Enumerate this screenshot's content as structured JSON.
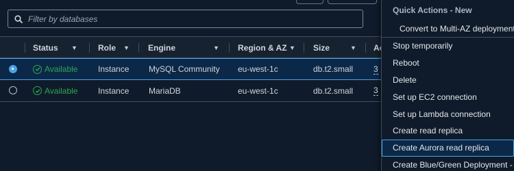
{
  "search": {
    "placeholder": "Filter by databases",
    "value": ""
  },
  "table": {
    "columns": [
      "Status",
      "Role",
      "Engine",
      "Region & AZ",
      "Size",
      "Ac"
    ],
    "rows": [
      {
        "selected": true,
        "status": "Available",
        "role": "Instance",
        "engine": "MySQL Community",
        "region": "eu-west-1c",
        "size": "db.t2.small",
        "ac": "3"
      },
      {
        "selected": false,
        "status": "Available",
        "role": "Instance",
        "engine": "MariaDB",
        "region": "eu-west-1c",
        "size": "db.t2.small",
        "ac": "3"
      }
    ]
  },
  "menu": {
    "group_label": "Quick Actions - New",
    "group_items": [
      "Convert to Multi-AZ deployment"
    ],
    "items": [
      "Stop temporarily",
      "Reboot",
      "Delete",
      "Set up EC2 connection",
      "Set up Lambda connection",
      "Create read replica",
      "Create Aurora read replica",
      "Create Blue/Green Deployment - n"
    ],
    "highlighted_index": 6
  },
  "colors": {
    "background": "#0f1b2a",
    "accent": "#4da3e6",
    "status_ok": "#2ea650",
    "selected_row": "#0c2848"
  },
  "icons": [
    "search-icon",
    "sort-caret-icon",
    "check-circle-icon",
    "radio-button-icon"
  ]
}
